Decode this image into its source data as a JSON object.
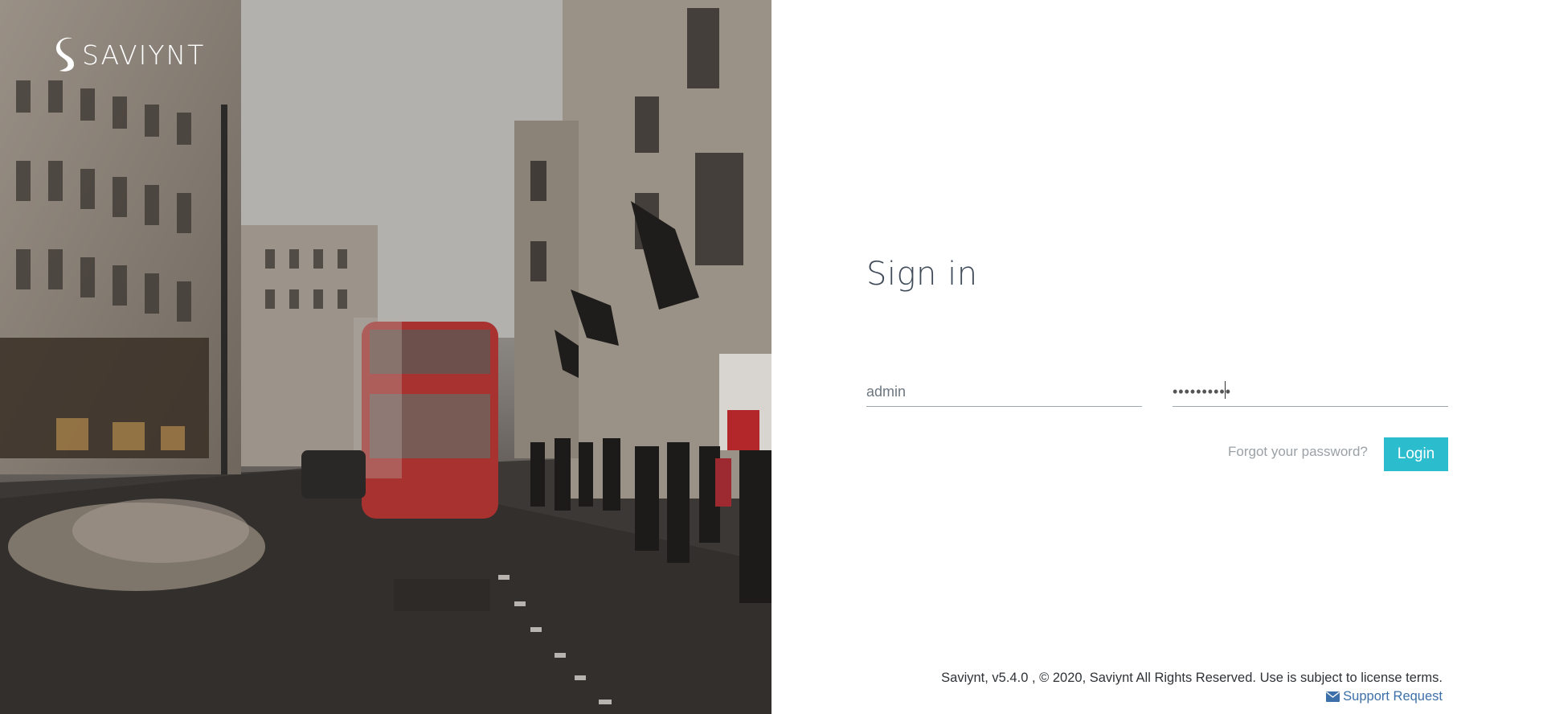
{
  "brand": {
    "logo_text": "SAVIYNT"
  },
  "signin": {
    "title": "Sign in",
    "username_value": "admin",
    "password_value": "••••••••••",
    "forgot_label": "Forgot your password?",
    "login_label": "Login"
  },
  "footer": {
    "copyright": "Saviynt, v5.4.0 , © 2020, Saviynt All Rights Reserved. Use is subject to license terms.",
    "support_label": "Support Request"
  },
  "colors": {
    "accent": "#2bbccd",
    "link": "#3d6fa8",
    "title": "#404b59"
  },
  "icons": {
    "logo": "saviynt-s-icon",
    "support": "envelope-icon"
  }
}
